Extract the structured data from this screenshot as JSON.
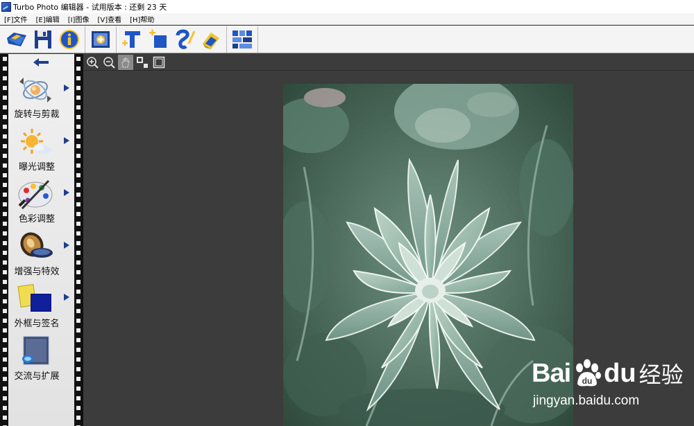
{
  "window": {
    "title": "Turbo Photo 编辑器 - 试用版本 : 还剩 23 天"
  },
  "menu": {
    "items": [
      {
        "label": "[F]文件"
      },
      {
        "label": "[E]编辑"
      },
      {
        "label": "[I]图像"
      },
      {
        "label": "[V]查看"
      },
      {
        "label": "[H]帮助"
      }
    ]
  },
  "toolbar": {
    "buttons": [
      {
        "icon": "open-folder-icon"
      },
      {
        "icon": "save-disk-icon"
      },
      {
        "icon": "info-icon"
      },
      {
        "icon": "add-image-icon"
      },
      {
        "icon": "add-text-icon"
      },
      {
        "icon": "add-layer-icon"
      },
      {
        "icon": "brush-icon"
      },
      {
        "icon": "eraser-icon"
      },
      {
        "icon": "collage-grid-icon"
      }
    ]
  },
  "zoom": {
    "tools": [
      "zoom-in-icon",
      "zoom-out-icon",
      "pan-hand-icon",
      "actual-size-icon",
      "fit-window-icon"
    ]
  },
  "sidebar": {
    "items": [
      {
        "label": "旋转与剪裁",
        "icon": "rotate-crop-icon"
      },
      {
        "label": "曝光调整",
        "icon": "exposure-sun-icon"
      },
      {
        "label": "色彩调整",
        "icon": "color-palette-icon"
      },
      {
        "label": "增强与特效",
        "icon": "filter-lens-icon"
      },
      {
        "label": "外框与签名",
        "icon": "frame-signature-icon"
      },
      {
        "label": "交流与扩展",
        "icon": "share-extend-icon"
      }
    ]
  },
  "watermark": {
    "bai": "Bai",
    "du": "du",
    "jingyan": "经验",
    "url": "jingyan.baidu.com"
  },
  "colors": {
    "canvas_bg": "#3c3c3c",
    "toolbar_bg": "#f4f4f4",
    "accent_blue": "#1d3f8c"
  }
}
